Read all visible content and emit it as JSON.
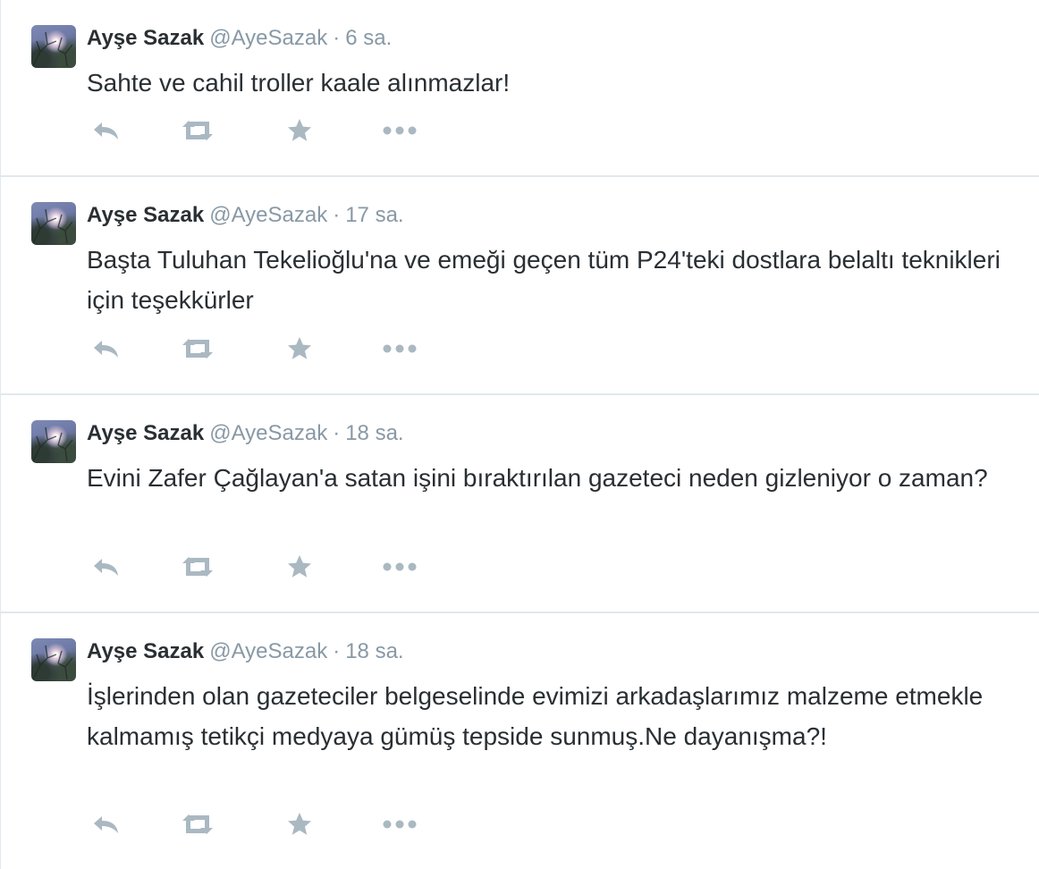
{
  "colors": {
    "name": "#292f33",
    "meta": "#8899a6",
    "icon": "#aab8c2",
    "divider": "#e1e8ed"
  },
  "tweets": [
    {
      "fullname": "Ayşe Sazak",
      "username": "@AyeSazak",
      "separator": "·",
      "time": "6 sa.",
      "text": "Sahte ve cahil troller kaale alınmazlar!"
    },
    {
      "fullname": "Ayşe Sazak",
      "username": "@AyeSazak",
      "separator": "·",
      "time": "17 sa.",
      "text": "Başta Tuluhan Tekelioğlu'na ve emeği geçen tüm P24'teki dostlara belaltı teknikleri için teşekkürler"
    },
    {
      "fullname": "Ayşe Sazak",
      "username": "@AyeSazak",
      "separator": "·",
      "time": "18 sa.",
      "text": "Evini Zafer Çağlayan'a satan işini bıraktırılan gazeteci neden gizleniyor o zaman?"
    },
    {
      "fullname": "Ayşe Sazak",
      "username": "@AyeSazak",
      "separator": "·",
      "time": "18 sa.",
      "text": "İşlerinden olan gazeteciler belgeselinde evimizi arkadaşlarımız malzeme etmekle kalmamış tetikçi medyaya gümüş tepside sunmuş.Ne dayanışma?!"
    }
  ],
  "action_icons": [
    "reply-icon",
    "retweet-icon",
    "favorite-star-icon",
    "more-dots-icon"
  ]
}
